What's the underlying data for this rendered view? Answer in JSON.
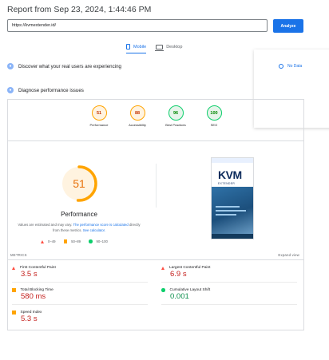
{
  "report": {
    "title": "Report from Sep 23, 2024, 1:44:46 PM"
  },
  "url_input": {
    "value": "https://kvmextender.id/"
  },
  "analyze_button": {
    "label": "Analyze"
  },
  "device_tabs": [
    {
      "label": "Mobile",
      "active": true,
      "icon": "phone-icon"
    },
    {
      "label": "Desktop",
      "active": false,
      "icon": "desktop-icon"
    }
  ],
  "sections": {
    "real_users": {
      "label": "Discover what your real users are experiencing",
      "icon": "users-icon"
    },
    "diagnose": {
      "label": "Diagnose performance issues",
      "icon": "gauge-icon"
    }
  },
  "overlay": {
    "no_data_label": "No Data"
  },
  "category_scores": [
    {
      "label": "Performance",
      "score": "51",
      "status": "orange"
    },
    {
      "label": "Accessibility",
      "score": "88",
      "status": "orange"
    },
    {
      "label": "Best Practices",
      "score": "96",
      "status": "green"
    },
    {
      "label": "SEO",
      "score": "100",
      "status": "green"
    }
  ],
  "performance": {
    "score": "51",
    "score_fraction": 0.51,
    "label": "Performance",
    "note_prefix": "Values are estimated and may vary.",
    "note_link1": "The performance score is calculated",
    "note_middle": "directly from these metrics.",
    "note_link2": "See calculator."
  },
  "legend": [
    {
      "range": "0–49",
      "shape": "triangle",
      "color": "#ff4e42"
    },
    {
      "range": "50–89",
      "shape": "square",
      "color": "#ffa400"
    },
    {
      "range": "90–100",
      "shape": "circle",
      "color": "#0cce6b"
    }
  ],
  "screenshot": {
    "logo_text": "KVM",
    "logo_sub": "EXTENDER"
  },
  "metrics": {
    "header": "METRICS",
    "expand_label": "Expand view",
    "items": [
      {
        "label": "First Contentful Paint",
        "value": "3.5 s",
        "status": "red"
      },
      {
        "label": "Largest Contentful Paint",
        "value": "6.9 s",
        "status": "red"
      },
      {
        "label": "Total Blocking Time",
        "value": "580 ms",
        "status": "orange"
      },
      {
        "label": "Cumulative Layout Shift",
        "value": "0.001",
        "status": "green"
      },
      {
        "label": "Speed Index",
        "value": "5.3 s",
        "status": "orange"
      }
    ]
  },
  "colors": {
    "accent": "#1a73e8",
    "fail": "#ff4e42",
    "average": "#ffa400",
    "pass": "#0cce6b"
  }
}
